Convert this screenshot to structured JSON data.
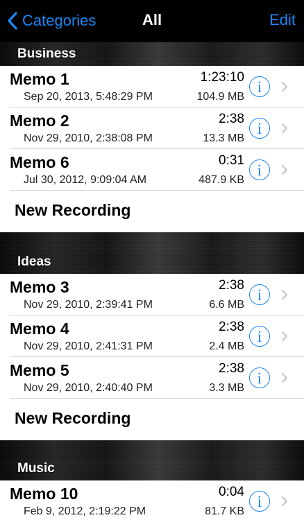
{
  "nav": {
    "back_label": "Categories",
    "title": "All",
    "edit_label": "Edit"
  },
  "colors": {
    "accent": "#1a86f4",
    "navbar_bg": "#000000"
  },
  "sections": [
    {
      "title": "Business",
      "memos": [
        {
          "name": "Memo 1",
          "date": "Sep 20, 2013, 5:48:29 PM",
          "duration": "1:23:10",
          "size": "104.9 MB"
        },
        {
          "name": "Memo 2",
          "date": "Nov 29, 2010, 2:38:08 PM",
          "duration": "2:38",
          "size": "13.3 MB"
        },
        {
          "name": "Memo 6",
          "date": "Jul 30, 2012, 9:09:04 AM",
          "duration": "0:31",
          "size": "487.9 KB"
        }
      ],
      "new_recording_label": "New Recording"
    },
    {
      "title": "Ideas",
      "memos": [
        {
          "name": "Memo 3",
          "date": "Nov 29, 2010, 2:39:41 PM",
          "duration": "2:38",
          "size": "6.6 MB"
        },
        {
          "name": "Memo 4",
          "date": "Nov 29, 2010, 2:41:31 PM",
          "duration": "2:38",
          "size": "2.4 MB"
        },
        {
          "name": "Memo 5",
          "date": "Nov 29, 2010, 2:40:40 PM",
          "duration": "2:38",
          "size": "3.3 MB"
        }
      ],
      "new_recording_label": "New Recording"
    },
    {
      "title": "Music",
      "memos": [
        {
          "name": "Memo 10",
          "date": "Feb 9, 2012, 2:19:22 PM",
          "duration": "0:04",
          "size": "81.7 KB"
        }
      ]
    }
  ],
  "icons": {
    "back": "chevron-left-icon",
    "info": "info-icon",
    "info_glyph": "i",
    "disclosure": "chevron-right-icon"
  }
}
